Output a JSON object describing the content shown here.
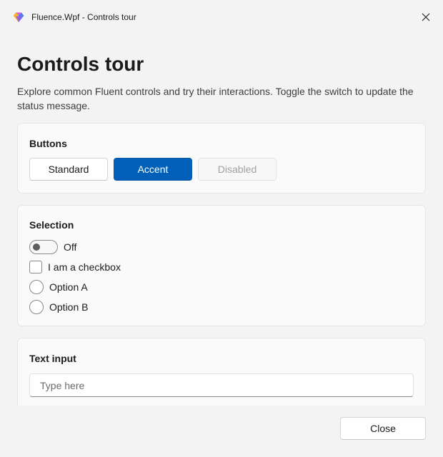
{
  "window": {
    "title": "Fluence.Wpf - Controls tour",
    "logo_icon": "fluence-app-logo-icon",
    "close_icon": "close-icon"
  },
  "page": {
    "title": "Controls tour",
    "description": "Explore common Fluent controls and try their interactions. Toggle the switch to update the status message."
  },
  "buttons_card": {
    "title": "Buttons",
    "standard_label": "Standard",
    "accent_label": "Accent",
    "disabled_label": "Disabled"
  },
  "selection_card": {
    "title": "Selection",
    "toggle_label": "Off",
    "toggle_on": false,
    "checkbox_label": "I am a checkbox",
    "checkbox_checked": false,
    "radio_a_label": "Option A",
    "radio_b_label": "Option B"
  },
  "text_card": {
    "title": "Text input",
    "placeholder": "Type here",
    "value": ""
  },
  "footer": {
    "close_label": "Close"
  },
  "colors": {
    "accent": "#005fb8",
    "background": "#f3f3f3",
    "card": "#fafafa"
  }
}
